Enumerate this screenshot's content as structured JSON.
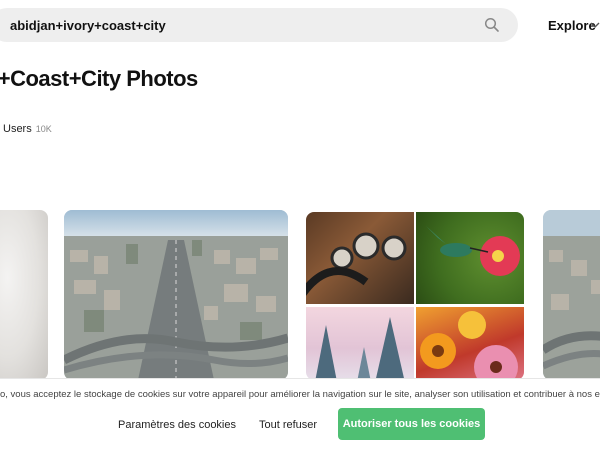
{
  "search": {
    "value": "abidjan+ivory+coast+city",
    "icon": "search-icon"
  },
  "nav": {
    "explore_label": "Explore",
    "explore_icon": "chevron-down-icon"
  },
  "page": {
    "title": "y+Coast+City Photos",
    "tabs": [
      {
        "label": "Users",
        "count": "10K"
      }
    ]
  },
  "photos": [
    {
      "subject": "cloudy sky"
    },
    {
      "subject": "aerial city highway interchange"
    },
    {
      "subject": "collage: car dashboard, hummingbird and flower, snowy trees at sunset, gerbera daisies"
    },
    {
      "subject": "aerial city highway interchange"
    }
  ],
  "cookie_banner": {
    "text": "o, vous acceptez le stockage de cookies sur votre appareil pour améliorer la navigation sur le site, analyser son utilisation et contribuer à nos ef",
    "params_label": "Paramètres des cookies",
    "refuse_label": "Tout refuser",
    "accept_label": "Autoriser tous les cookies",
    "accept_color": "#4fbf73"
  }
}
